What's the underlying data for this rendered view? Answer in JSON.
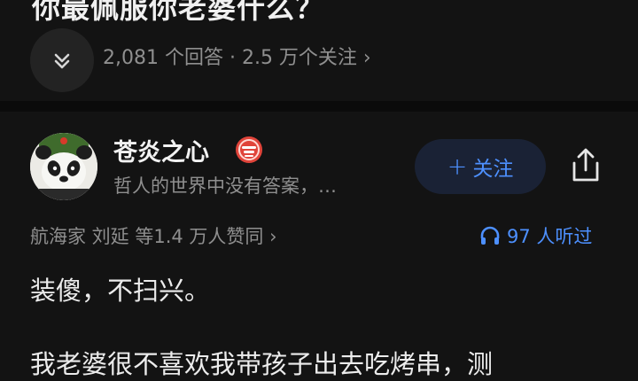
{
  "question": {
    "title": "你最佩服你老婆什么？",
    "meta": "2,081 个回答 · 2.5 万个关注 ›"
  },
  "author": {
    "name": "苍炎之心",
    "bio": "哲人的世界中没有答案，…",
    "follow_label": "关注",
    "follow_icon": "plus-icon",
    "badge_icon": "badge-icon",
    "share_icon": "share-icon"
  },
  "stats": {
    "voters": "航海家 刘延 等1.4 万人赞同 ›",
    "listeners": "97 人听过",
    "listen_icon": "headphones-icon"
  },
  "answer": {
    "first_line": "装傻，不扫兴。",
    "second_line": "我老婆很不喜欢我带孩子出去吃烤串，测"
  },
  "colors": {
    "background": "#131313",
    "accent": "#4d90ff",
    "badge": "#e0443a"
  }
}
